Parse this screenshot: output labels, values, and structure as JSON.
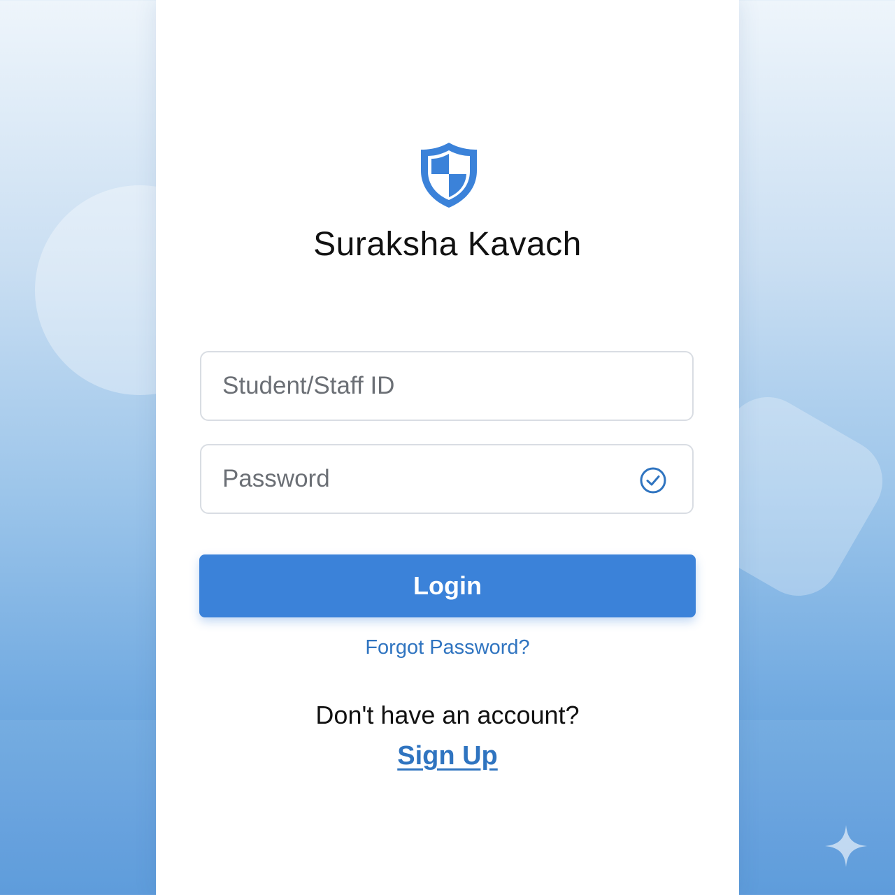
{
  "app": {
    "title": "Suraksha Kavach",
    "logo_icon": "shield-icon"
  },
  "form": {
    "id_field": {
      "value": "",
      "placeholder": "Student/Staff ID"
    },
    "password_field": {
      "value": "",
      "placeholder": "Password",
      "status_icon": "check-circle-icon"
    },
    "login_label": "Login",
    "forgot_label": "Forgot Password?"
  },
  "signup": {
    "prompt": "Don't have an account?",
    "link_label": "Sign Up"
  },
  "colors": {
    "accent": "#3b82d9",
    "link": "#2f74c0",
    "background_top": "#eef5fb",
    "background_bottom": "#5596d9"
  }
}
